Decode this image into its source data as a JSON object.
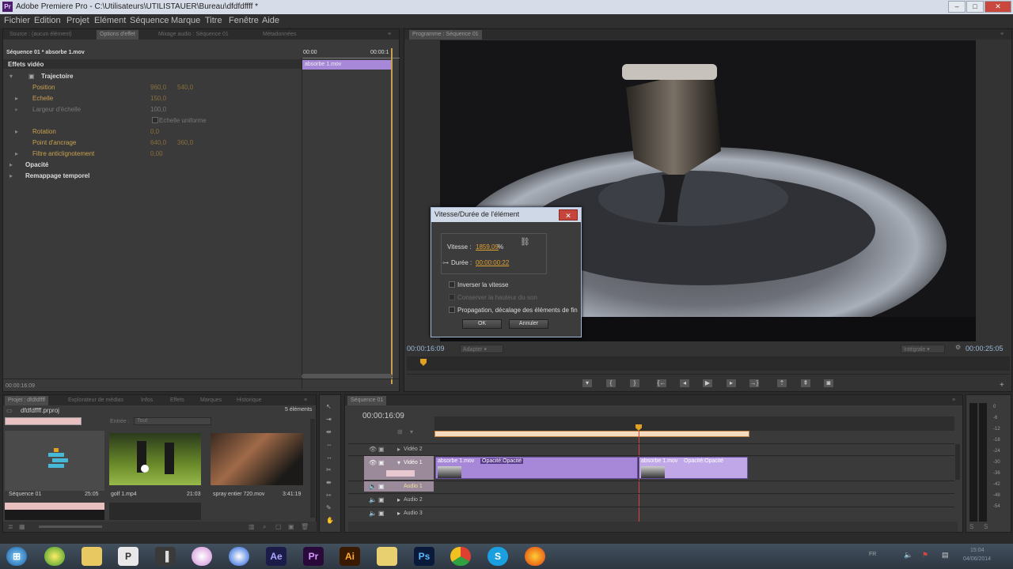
{
  "window": {
    "title": "Adobe Premiere Pro - C:\\Utilisateurs\\UTILISTAUER\\Bureau\\dfdfdffff *",
    "minimize": "–",
    "maximize": "□",
    "close": "✕"
  },
  "menu": [
    "Fichier",
    "Edition",
    "Projet",
    "Elément",
    "Séquence",
    "Marque",
    "Titre",
    "Fenêtre",
    "Aide"
  ],
  "effects_panel": {
    "tabs": [
      "Source : (aucun élément)",
      "Options d'effet",
      "Mixage audio : Séquence 01",
      "Métadonnées"
    ],
    "header": "Séquence 01 * absorbe 1.mov",
    "time_start": "00:00",
    "time_end": "00:00:1",
    "clip_label": "absorbe 1.mov",
    "section_video": "Effets vidéo",
    "rows": [
      {
        "label": "Trajectoire"
      },
      {
        "label": "Position",
        "v1": "960,0",
        "v2": "540,0"
      },
      {
        "label": "Echelle",
        "v1": "150,0"
      },
      {
        "label": "Largeur d'échelle",
        "v1": "100,0"
      },
      {
        "label": "Echelle uniforme"
      },
      {
        "label": "Rotation",
        "v1": "0,0"
      },
      {
        "label": "Point d'ancrage",
        "v1": "640,0",
        "v2": "360,0"
      },
      {
        "label": "Filtre anticlignotement",
        "v1": "0,00"
      },
      {
        "label": "Opacité"
      },
      {
        "label": "Remappage temporel"
      }
    ],
    "footer_time": "00:00:16:09"
  },
  "program_monitor": {
    "tab": "Programme : Séquence 01",
    "timecode_current": "00:00:16:09",
    "fit": "Adapter",
    "quality": "Intégrale",
    "timecode_total": "00:00:25:05",
    "transport_icons": [
      "marker-icon",
      "in-point-icon",
      "out-point-icon",
      "go-to-in-icon",
      "step-back-icon",
      "play-icon",
      "step-forward-icon",
      "go-to-out-icon",
      "lift-icon",
      "extract-icon",
      "export-frame-icon"
    ]
  },
  "dialog": {
    "title": "Vitesse/Durée de l'élément",
    "speed_label": "Vitesse :",
    "speed_value": "1859,09",
    "speed_unit": "%",
    "duration_label": "Durée :",
    "duration_value": "00:00:00:22",
    "reverse": "Inverser la vitesse",
    "keep_pitch": "Conserver la hauteur du son",
    "ripple": "Propagation, décalage des éléments de fin",
    "ok": "OK",
    "cancel": "Annuler"
  },
  "project_panel": {
    "tabs": [
      "Projet : dfdfdffff",
      "Explorateur de médias",
      "Infos",
      "Effets",
      "Marques",
      "Historique"
    ],
    "project_name": "dfdfdffff.prproj",
    "count": "5 éléments",
    "entry_label": "Entrée :",
    "entry_value": "Tout",
    "items": [
      {
        "name": "Séquence 01",
        "duration": "25:05"
      },
      {
        "name": "golf 1.mp4",
        "duration": "21:03"
      },
      {
        "name": "spray entier 720.mov",
        "duration": "3:41:19"
      }
    ]
  },
  "timeline": {
    "tab": "Séquence 01",
    "timecode": "00:00:16:09",
    "tracks": [
      "Vidéo 2",
      "Vidéo 1",
      "Audio 1",
      "Audio 2",
      "Audio 3"
    ],
    "clip1": {
      "name": "absorbe 1.mov",
      "effect": "Opacité:Opacité"
    },
    "clip2": {
      "name": "absorbe 1.mov",
      "effect": "Opacité:Opacité"
    }
  },
  "meter_scale": [
    "0",
    "-6",
    "-12",
    "-18",
    "-24",
    "-30",
    "-36",
    "-42",
    "-48",
    "-54"
  ],
  "taskbar": {
    "apps": [
      "Ae",
      "Pr",
      "Ai",
      "Ps"
    ],
    "lang": "FR",
    "time": "15:04",
    "date": "04/06/2014"
  },
  "colors": {
    "accent": "#a788d8",
    "playhead": "#e08a1f",
    "timeline_bar": "#f0d0a0"
  }
}
